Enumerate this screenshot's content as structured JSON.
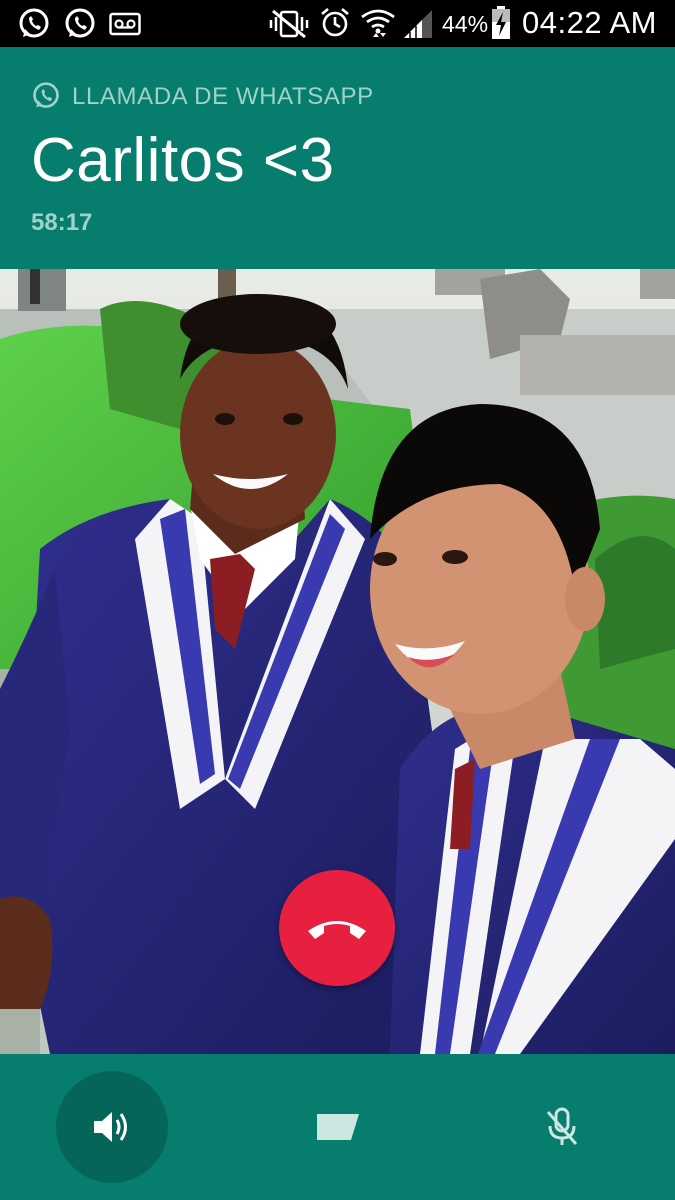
{
  "status_bar": {
    "battery_percent": "44%",
    "time": "04:22 AM",
    "left_icons": [
      "whatsapp-icon",
      "whatsapp-icon",
      "voicemail-icon"
    ],
    "right_icons": [
      "vibrate-mute-icon",
      "alarm-icon",
      "wifi-icon",
      "signal-icon",
      "battery-charging-icon"
    ]
  },
  "call": {
    "label": "LLAMADA DE WHATSAPP",
    "contact_name": "Carlitos <3",
    "duration": "58:17"
  },
  "controls": {
    "end_call": "end-call-icon",
    "speaker": "speaker-icon",
    "video": "video-icon",
    "mute": "microphone-muted-icon"
  },
  "colors": {
    "header_bg": "#077d6d",
    "status_bar_bg": "#000000",
    "end_call": "#e8203f",
    "label_text": "#9fd2c8"
  }
}
